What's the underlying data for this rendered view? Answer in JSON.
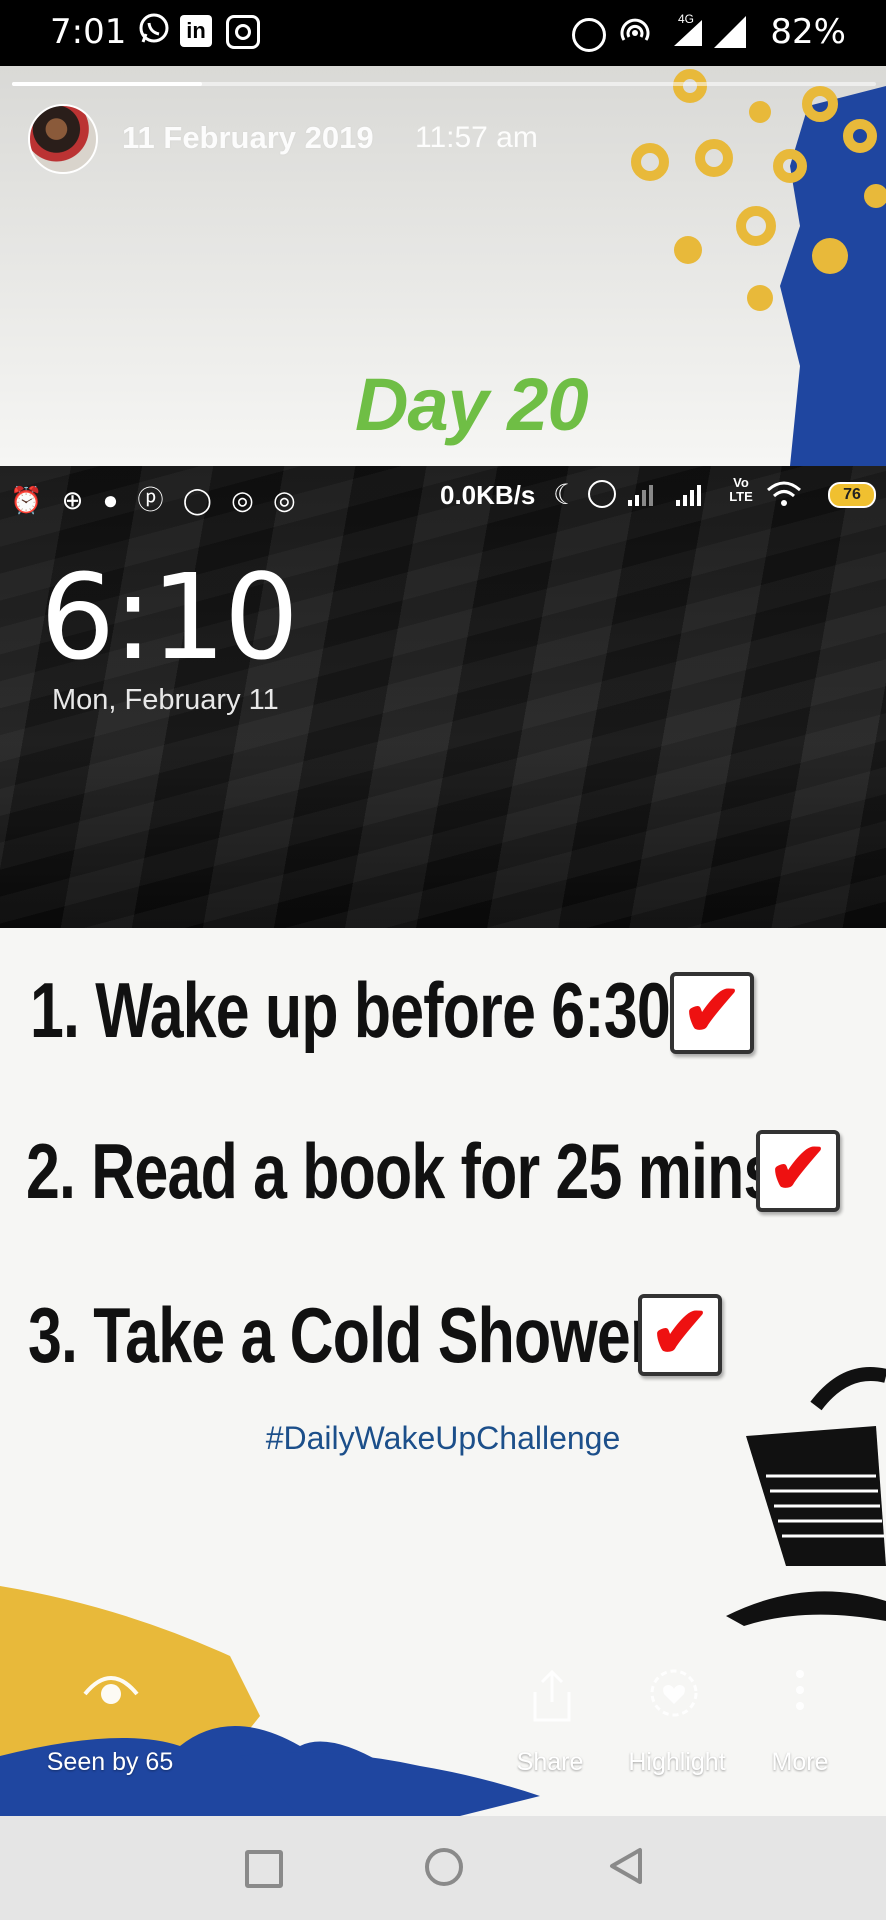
{
  "status_bar": {
    "time": "7:01",
    "left_icons": [
      "whatsapp-icon",
      "linkedin-icon",
      "instagram-icon"
    ],
    "right_icons": [
      "alarm-icon",
      "hotspot-icon",
      "4g-signal-icon",
      "signal-icon"
    ],
    "network_label": "4G",
    "battery": "82%"
  },
  "story": {
    "progress": 0.22,
    "date": "11 February 2019",
    "time": "11:57 am",
    "day_title": "Day 20",
    "lock_screen": {
      "net_speed": "0.0KB/s",
      "battery_level": "76",
      "lte_label": "Vo LTE",
      "clock": "6:10",
      "date": "Mon, February 11"
    },
    "tasks": [
      {
        "text": "1. Wake up before 6:30",
        "checked": true
      },
      {
        "text": "2. Read a book for 25 mins",
        "checked": true
      },
      {
        "text": "3. Take a Cold Shower",
        "checked": true
      }
    ],
    "hashtag": "#DailyWakeUpChallenge",
    "check_glyph": "✔"
  },
  "actions": {
    "seen_by": "Seen by 65",
    "share": "Share",
    "highlight": "Highlight",
    "more": "More"
  },
  "colors": {
    "accent_green": "#6fbe45",
    "blue_brush": "#1f46a0",
    "yellow_brush": "#e8b93a",
    "hashtag_blue": "#1c4f8a",
    "check_red": "#e11111"
  }
}
